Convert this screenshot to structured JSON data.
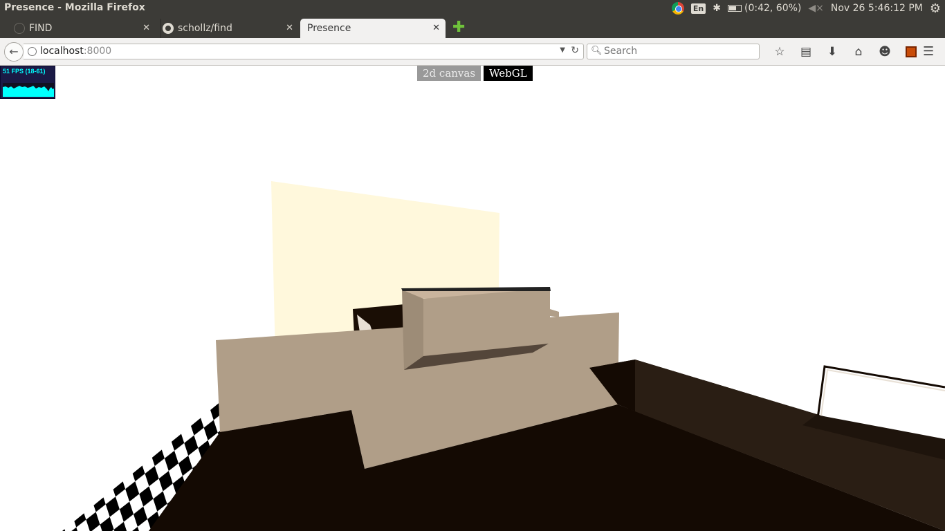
{
  "window": {
    "title": "Presence - Mozilla Firefox"
  },
  "panel": {
    "keyboard_layout": "En",
    "battery": "(0:42, 60%)",
    "clock": "Nov 26  5:46:12 PM",
    "icons": [
      "chrome-icon",
      "keyboard-icon",
      "bluetooth-icon",
      "battery-icon",
      "volume-icon",
      "gear-icon"
    ]
  },
  "tabs": [
    {
      "label": "FIND",
      "active": false
    },
    {
      "label": "schollz/find",
      "active": false
    },
    {
      "label": "Presence",
      "active": true
    }
  ],
  "nav": {
    "url_host": "localhost",
    "url_port": ":8000",
    "search_placeholder": "Search"
  },
  "page": {
    "fps_label": "51 FPS (18-61)",
    "mode_buttons": {
      "canvas2d": "2d canvas",
      "webgl": "WebGL"
    },
    "active_mode": "WebGL"
  },
  "colors": {
    "wall": "#fff8dc",
    "furniture": "#b09e88",
    "dark_floor": "#140a03",
    "panel_bg": "#3c3b37",
    "fps_text": "#00ffff"
  }
}
